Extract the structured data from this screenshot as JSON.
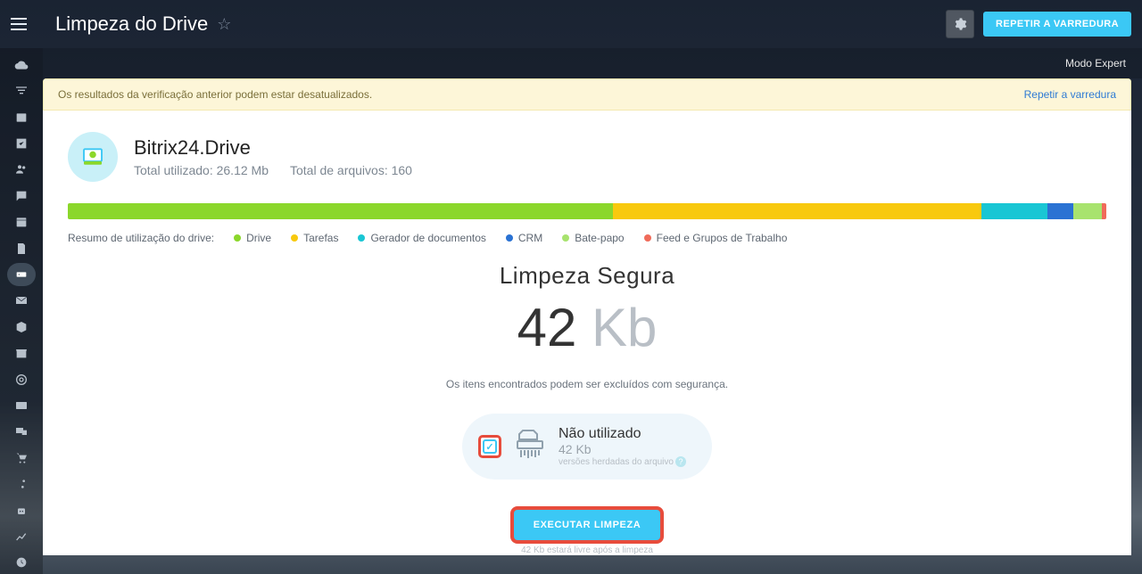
{
  "header": {
    "page_title": "Limpeza do Drive",
    "repeat_button": "REPETIR A VARREDURA",
    "mode_label": "Modo Expert"
  },
  "notice": {
    "text": "Os resultados da verificação anterior podem estar desatualizados.",
    "action": "Repetir a varredura"
  },
  "drive": {
    "name": "Bitrix24.Drive",
    "total_used_label": "Total utilizado:",
    "total_used_value": "26.12 Mb",
    "total_files_label": "Total de arquivos:",
    "total_files_value": "160"
  },
  "legend": {
    "summary_label": "Resumo de utilização do drive:",
    "items": [
      {
        "label": "Drive"
      },
      {
        "label": "Tarefas"
      },
      {
        "label": "Gerador de documentos"
      },
      {
        "label": "CRM"
      },
      {
        "label": "Bate-papo"
      },
      {
        "label": "Feed e Grupos de Trabalho"
      }
    ]
  },
  "cleanup": {
    "title": "Limpeza Segura",
    "value": "42",
    "unit": "Kb",
    "safe_text": "Os itens encontrados podem ser excluídos com segurança.",
    "pill_title": "Não utilizado",
    "pill_size": "42 Kb",
    "pill_sub": "versões herdadas do arquivo",
    "exec_button": "EXECUTAR LIMPEZA",
    "exec_sub": "42 Kb estará livre após a limpeza"
  },
  "chart_data": {
    "type": "bar",
    "title": "Resumo de utilização do drive",
    "categories": [
      "Drive",
      "Tarefas",
      "Gerador de documentos",
      "CRM",
      "Bate-papo",
      "Feed e Grupos de Trabalho"
    ],
    "values_pct": [
      52.5,
      35.5,
      6.3,
      2.5,
      2.8,
      0.4
    ],
    "colors": [
      "#8bd72b",
      "#f8c90e",
      "#19c6d4",
      "#2a72d3",
      "#a8e36e",
      "#f06b5a"
    ],
    "xlabel": "",
    "ylabel": "",
    "ylim": [
      0,
      100
    ]
  }
}
